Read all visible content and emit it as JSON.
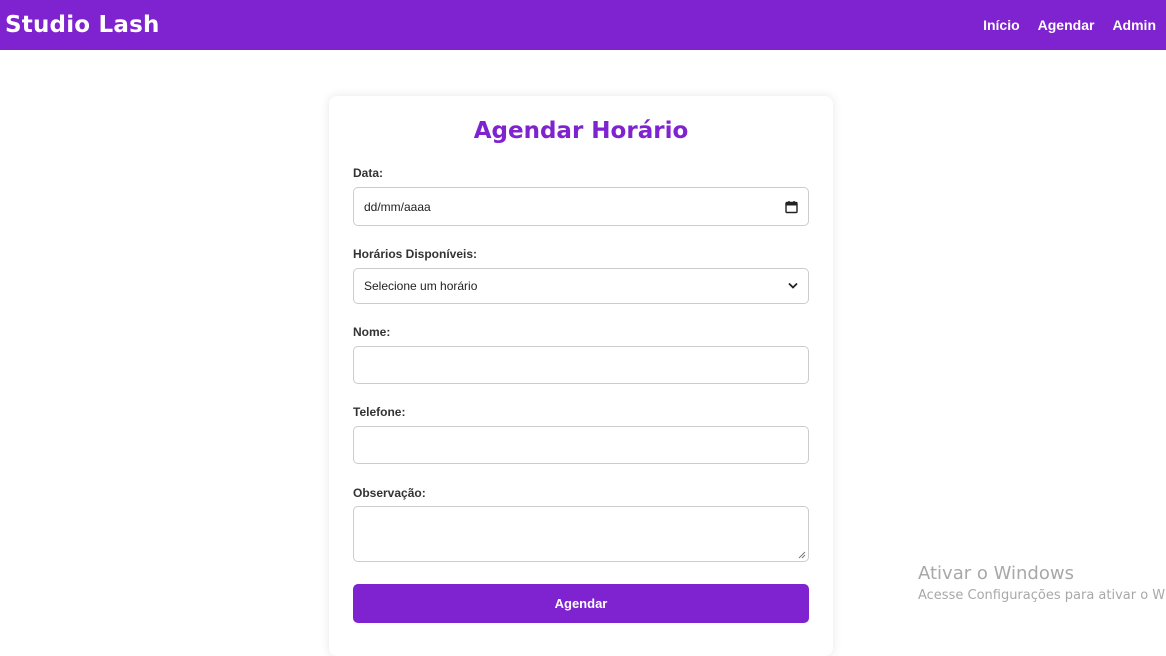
{
  "navbar": {
    "brand": "Studio Lash",
    "links": [
      "Início",
      "Agendar",
      "Admin"
    ]
  },
  "form": {
    "title": "Agendar Horário",
    "date": {
      "label": "Data:",
      "value": "dd/mm/aaaa",
      "icon": "calendar-icon"
    },
    "time": {
      "label": "Horários Disponíveis:",
      "selected": "Selecione um horário",
      "icon": "chevron-down-icon"
    },
    "name": {
      "label": "Nome:",
      "value": ""
    },
    "phone": {
      "label": "Telefone:",
      "value": ""
    },
    "notes": {
      "label": "Observação:",
      "value": "",
      "icon": "resize-handle-icon"
    },
    "submit_label": "Agendar"
  },
  "watermark": {
    "title": "Ativar o Windows",
    "subtitle": "Acesse Configurações para ativar o Windows."
  },
  "colors": {
    "primary": "#7f22cf",
    "background": "#ffffff",
    "border": "#cccccc",
    "text": "#333333"
  }
}
